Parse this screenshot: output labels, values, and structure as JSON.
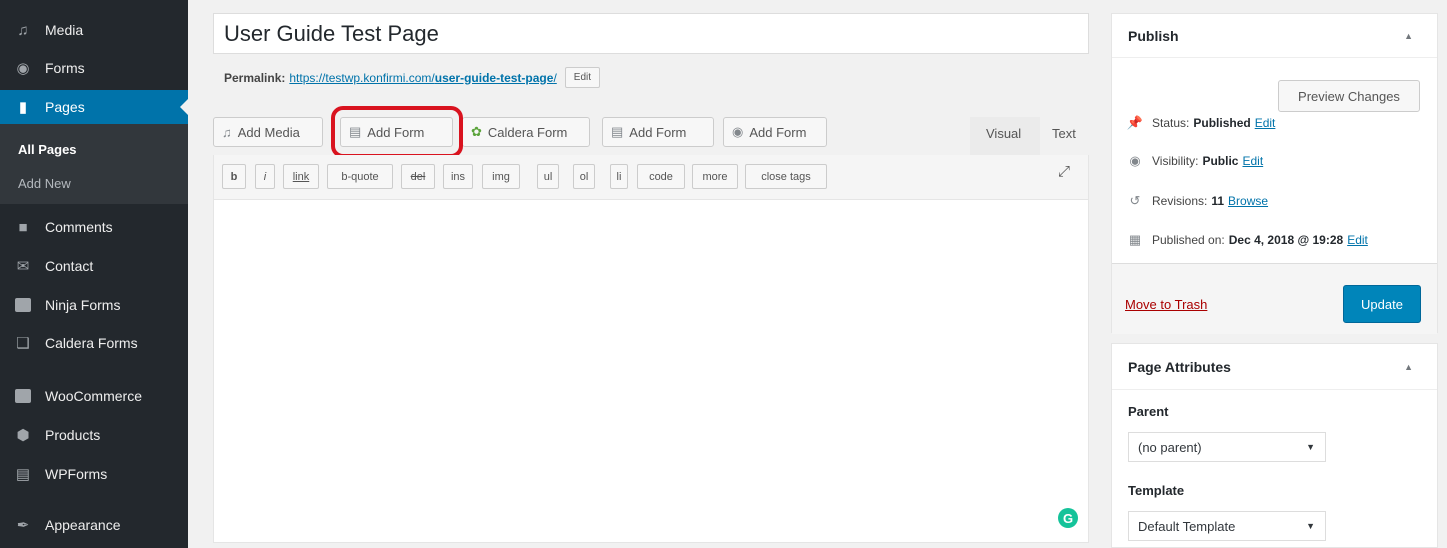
{
  "sidebar": {
    "items": [
      {
        "label": "Media",
        "icon": "media-icon"
      },
      {
        "label": "Forms",
        "icon": "forms-icon"
      },
      {
        "label": "Pages",
        "icon": "pages-icon"
      },
      {
        "label": "Comments",
        "icon": "comments-icon"
      },
      {
        "label": "Contact",
        "icon": "contact-icon"
      },
      {
        "label": "Ninja Forms",
        "icon": "ninja-forms-icon"
      },
      {
        "label": "Caldera Forms",
        "icon": "caldera-forms-icon"
      },
      {
        "label": "WooCommerce",
        "icon": "woocommerce-icon"
      },
      {
        "label": "Products",
        "icon": "products-icon"
      },
      {
        "label": "WPForms",
        "icon": "wpforms-icon"
      },
      {
        "label": "Appearance",
        "icon": "appearance-icon"
      }
    ],
    "submenu": {
      "all_pages": "All Pages",
      "add_new": "Add New"
    }
  },
  "editor": {
    "title": "User Guide Test Page",
    "permalink_label": "Permalink:",
    "permalink_base": "https://testwp.konfirmi.com/",
    "permalink_slug": "user-guide-test-page",
    "permalink_trailing": "/",
    "permalink_edit": "Edit",
    "media_buttons": {
      "add_media": "Add Media",
      "add_form": "Add Form",
      "caldera_form": "Caldera Form",
      "add_form_2": "Add Form",
      "add_form_3": "Add Form"
    },
    "tabs": {
      "visual": "Visual",
      "text": "Text"
    },
    "quicktags": [
      "b",
      "i",
      "link",
      "b-quote",
      "del",
      "ins",
      "img",
      "ul",
      "ol",
      "li",
      "code",
      "more",
      "close tags"
    ],
    "content": ""
  },
  "publish": {
    "title": "Publish",
    "preview": "Preview Changes",
    "status_label": "Status:",
    "status_value": "Published",
    "status_edit": "Edit",
    "visibility_label": "Visibility:",
    "visibility_value": "Public",
    "visibility_edit": "Edit",
    "revisions_label": "Revisions:",
    "revisions_value": "11",
    "revisions_link": "Browse",
    "published_label": "Published on:",
    "published_value": "Dec 4, 2018 @ 19:28",
    "published_edit": "Edit",
    "trash": "Move to Trash",
    "update": "Update"
  },
  "page_attributes": {
    "title": "Page Attributes",
    "parent_label": "Parent",
    "parent_value": "(no parent)",
    "template_label": "Template",
    "template_value": "Default Template"
  },
  "colors": {
    "sidebar_bg": "#23282d",
    "active": "#0073aa",
    "highlight": "#d9131f",
    "primary_button": "#0085ba"
  }
}
